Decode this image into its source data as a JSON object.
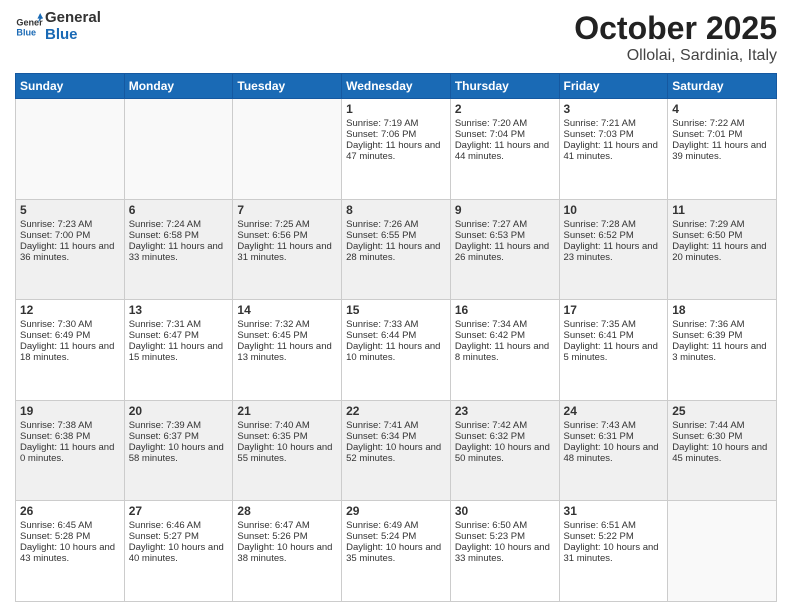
{
  "logo": {
    "line1": "General",
    "line2": "Blue"
  },
  "title": "October 2025",
  "subtitle": "Ollolai, Sardinia, Italy",
  "days_of_week": [
    "Sunday",
    "Monday",
    "Tuesday",
    "Wednesday",
    "Thursday",
    "Friday",
    "Saturday"
  ],
  "weeks": [
    [
      {
        "day": "",
        "sunrise": "",
        "sunset": "",
        "daylight": ""
      },
      {
        "day": "",
        "sunrise": "",
        "sunset": "",
        "daylight": ""
      },
      {
        "day": "",
        "sunrise": "",
        "sunset": "",
        "daylight": ""
      },
      {
        "day": "1",
        "sunrise": "Sunrise: 7:19 AM",
        "sunset": "Sunset: 7:06 PM",
        "daylight": "Daylight: 11 hours and 47 minutes."
      },
      {
        "day": "2",
        "sunrise": "Sunrise: 7:20 AM",
        "sunset": "Sunset: 7:04 PM",
        "daylight": "Daylight: 11 hours and 44 minutes."
      },
      {
        "day": "3",
        "sunrise": "Sunrise: 7:21 AM",
        "sunset": "Sunset: 7:03 PM",
        "daylight": "Daylight: 11 hours and 41 minutes."
      },
      {
        "day": "4",
        "sunrise": "Sunrise: 7:22 AM",
        "sunset": "Sunset: 7:01 PM",
        "daylight": "Daylight: 11 hours and 39 minutes."
      }
    ],
    [
      {
        "day": "5",
        "sunrise": "Sunrise: 7:23 AM",
        "sunset": "Sunset: 7:00 PM",
        "daylight": "Daylight: 11 hours and 36 minutes."
      },
      {
        "day": "6",
        "sunrise": "Sunrise: 7:24 AM",
        "sunset": "Sunset: 6:58 PM",
        "daylight": "Daylight: 11 hours and 33 minutes."
      },
      {
        "day": "7",
        "sunrise": "Sunrise: 7:25 AM",
        "sunset": "Sunset: 6:56 PM",
        "daylight": "Daylight: 11 hours and 31 minutes."
      },
      {
        "day": "8",
        "sunrise": "Sunrise: 7:26 AM",
        "sunset": "Sunset: 6:55 PM",
        "daylight": "Daylight: 11 hours and 28 minutes."
      },
      {
        "day": "9",
        "sunrise": "Sunrise: 7:27 AM",
        "sunset": "Sunset: 6:53 PM",
        "daylight": "Daylight: 11 hours and 26 minutes."
      },
      {
        "day": "10",
        "sunrise": "Sunrise: 7:28 AM",
        "sunset": "Sunset: 6:52 PM",
        "daylight": "Daylight: 11 hours and 23 minutes."
      },
      {
        "day": "11",
        "sunrise": "Sunrise: 7:29 AM",
        "sunset": "Sunset: 6:50 PM",
        "daylight": "Daylight: 11 hours and 20 minutes."
      }
    ],
    [
      {
        "day": "12",
        "sunrise": "Sunrise: 7:30 AM",
        "sunset": "Sunset: 6:49 PM",
        "daylight": "Daylight: 11 hours and 18 minutes."
      },
      {
        "day": "13",
        "sunrise": "Sunrise: 7:31 AM",
        "sunset": "Sunset: 6:47 PM",
        "daylight": "Daylight: 11 hours and 15 minutes."
      },
      {
        "day": "14",
        "sunrise": "Sunrise: 7:32 AM",
        "sunset": "Sunset: 6:45 PM",
        "daylight": "Daylight: 11 hours and 13 minutes."
      },
      {
        "day": "15",
        "sunrise": "Sunrise: 7:33 AM",
        "sunset": "Sunset: 6:44 PM",
        "daylight": "Daylight: 11 hours and 10 minutes."
      },
      {
        "day": "16",
        "sunrise": "Sunrise: 7:34 AM",
        "sunset": "Sunset: 6:42 PM",
        "daylight": "Daylight: 11 hours and 8 minutes."
      },
      {
        "day": "17",
        "sunrise": "Sunrise: 7:35 AM",
        "sunset": "Sunset: 6:41 PM",
        "daylight": "Daylight: 11 hours and 5 minutes."
      },
      {
        "day": "18",
        "sunrise": "Sunrise: 7:36 AM",
        "sunset": "Sunset: 6:39 PM",
        "daylight": "Daylight: 11 hours and 3 minutes."
      }
    ],
    [
      {
        "day": "19",
        "sunrise": "Sunrise: 7:38 AM",
        "sunset": "Sunset: 6:38 PM",
        "daylight": "Daylight: 11 hours and 0 minutes."
      },
      {
        "day": "20",
        "sunrise": "Sunrise: 7:39 AM",
        "sunset": "Sunset: 6:37 PM",
        "daylight": "Daylight: 10 hours and 58 minutes."
      },
      {
        "day": "21",
        "sunrise": "Sunrise: 7:40 AM",
        "sunset": "Sunset: 6:35 PM",
        "daylight": "Daylight: 10 hours and 55 minutes."
      },
      {
        "day": "22",
        "sunrise": "Sunrise: 7:41 AM",
        "sunset": "Sunset: 6:34 PM",
        "daylight": "Daylight: 10 hours and 52 minutes."
      },
      {
        "day": "23",
        "sunrise": "Sunrise: 7:42 AM",
        "sunset": "Sunset: 6:32 PM",
        "daylight": "Daylight: 10 hours and 50 minutes."
      },
      {
        "day": "24",
        "sunrise": "Sunrise: 7:43 AM",
        "sunset": "Sunset: 6:31 PM",
        "daylight": "Daylight: 10 hours and 48 minutes."
      },
      {
        "day": "25",
        "sunrise": "Sunrise: 7:44 AM",
        "sunset": "Sunset: 6:30 PM",
        "daylight": "Daylight: 10 hours and 45 minutes."
      }
    ],
    [
      {
        "day": "26",
        "sunrise": "Sunrise: 6:45 AM",
        "sunset": "Sunset: 5:28 PM",
        "daylight": "Daylight: 10 hours and 43 minutes."
      },
      {
        "day": "27",
        "sunrise": "Sunrise: 6:46 AM",
        "sunset": "Sunset: 5:27 PM",
        "daylight": "Daylight: 10 hours and 40 minutes."
      },
      {
        "day": "28",
        "sunrise": "Sunrise: 6:47 AM",
        "sunset": "Sunset: 5:26 PM",
        "daylight": "Daylight: 10 hours and 38 minutes."
      },
      {
        "day": "29",
        "sunrise": "Sunrise: 6:49 AM",
        "sunset": "Sunset: 5:24 PM",
        "daylight": "Daylight: 10 hours and 35 minutes."
      },
      {
        "day": "30",
        "sunrise": "Sunrise: 6:50 AM",
        "sunset": "Sunset: 5:23 PM",
        "daylight": "Daylight: 10 hours and 33 minutes."
      },
      {
        "day": "31",
        "sunrise": "Sunrise: 6:51 AM",
        "sunset": "Sunset: 5:22 PM",
        "daylight": "Daylight: 10 hours and 31 minutes."
      },
      {
        "day": "",
        "sunrise": "",
        "sunset": "",
        "daylight": ""
      }
    ]
  ]
}
